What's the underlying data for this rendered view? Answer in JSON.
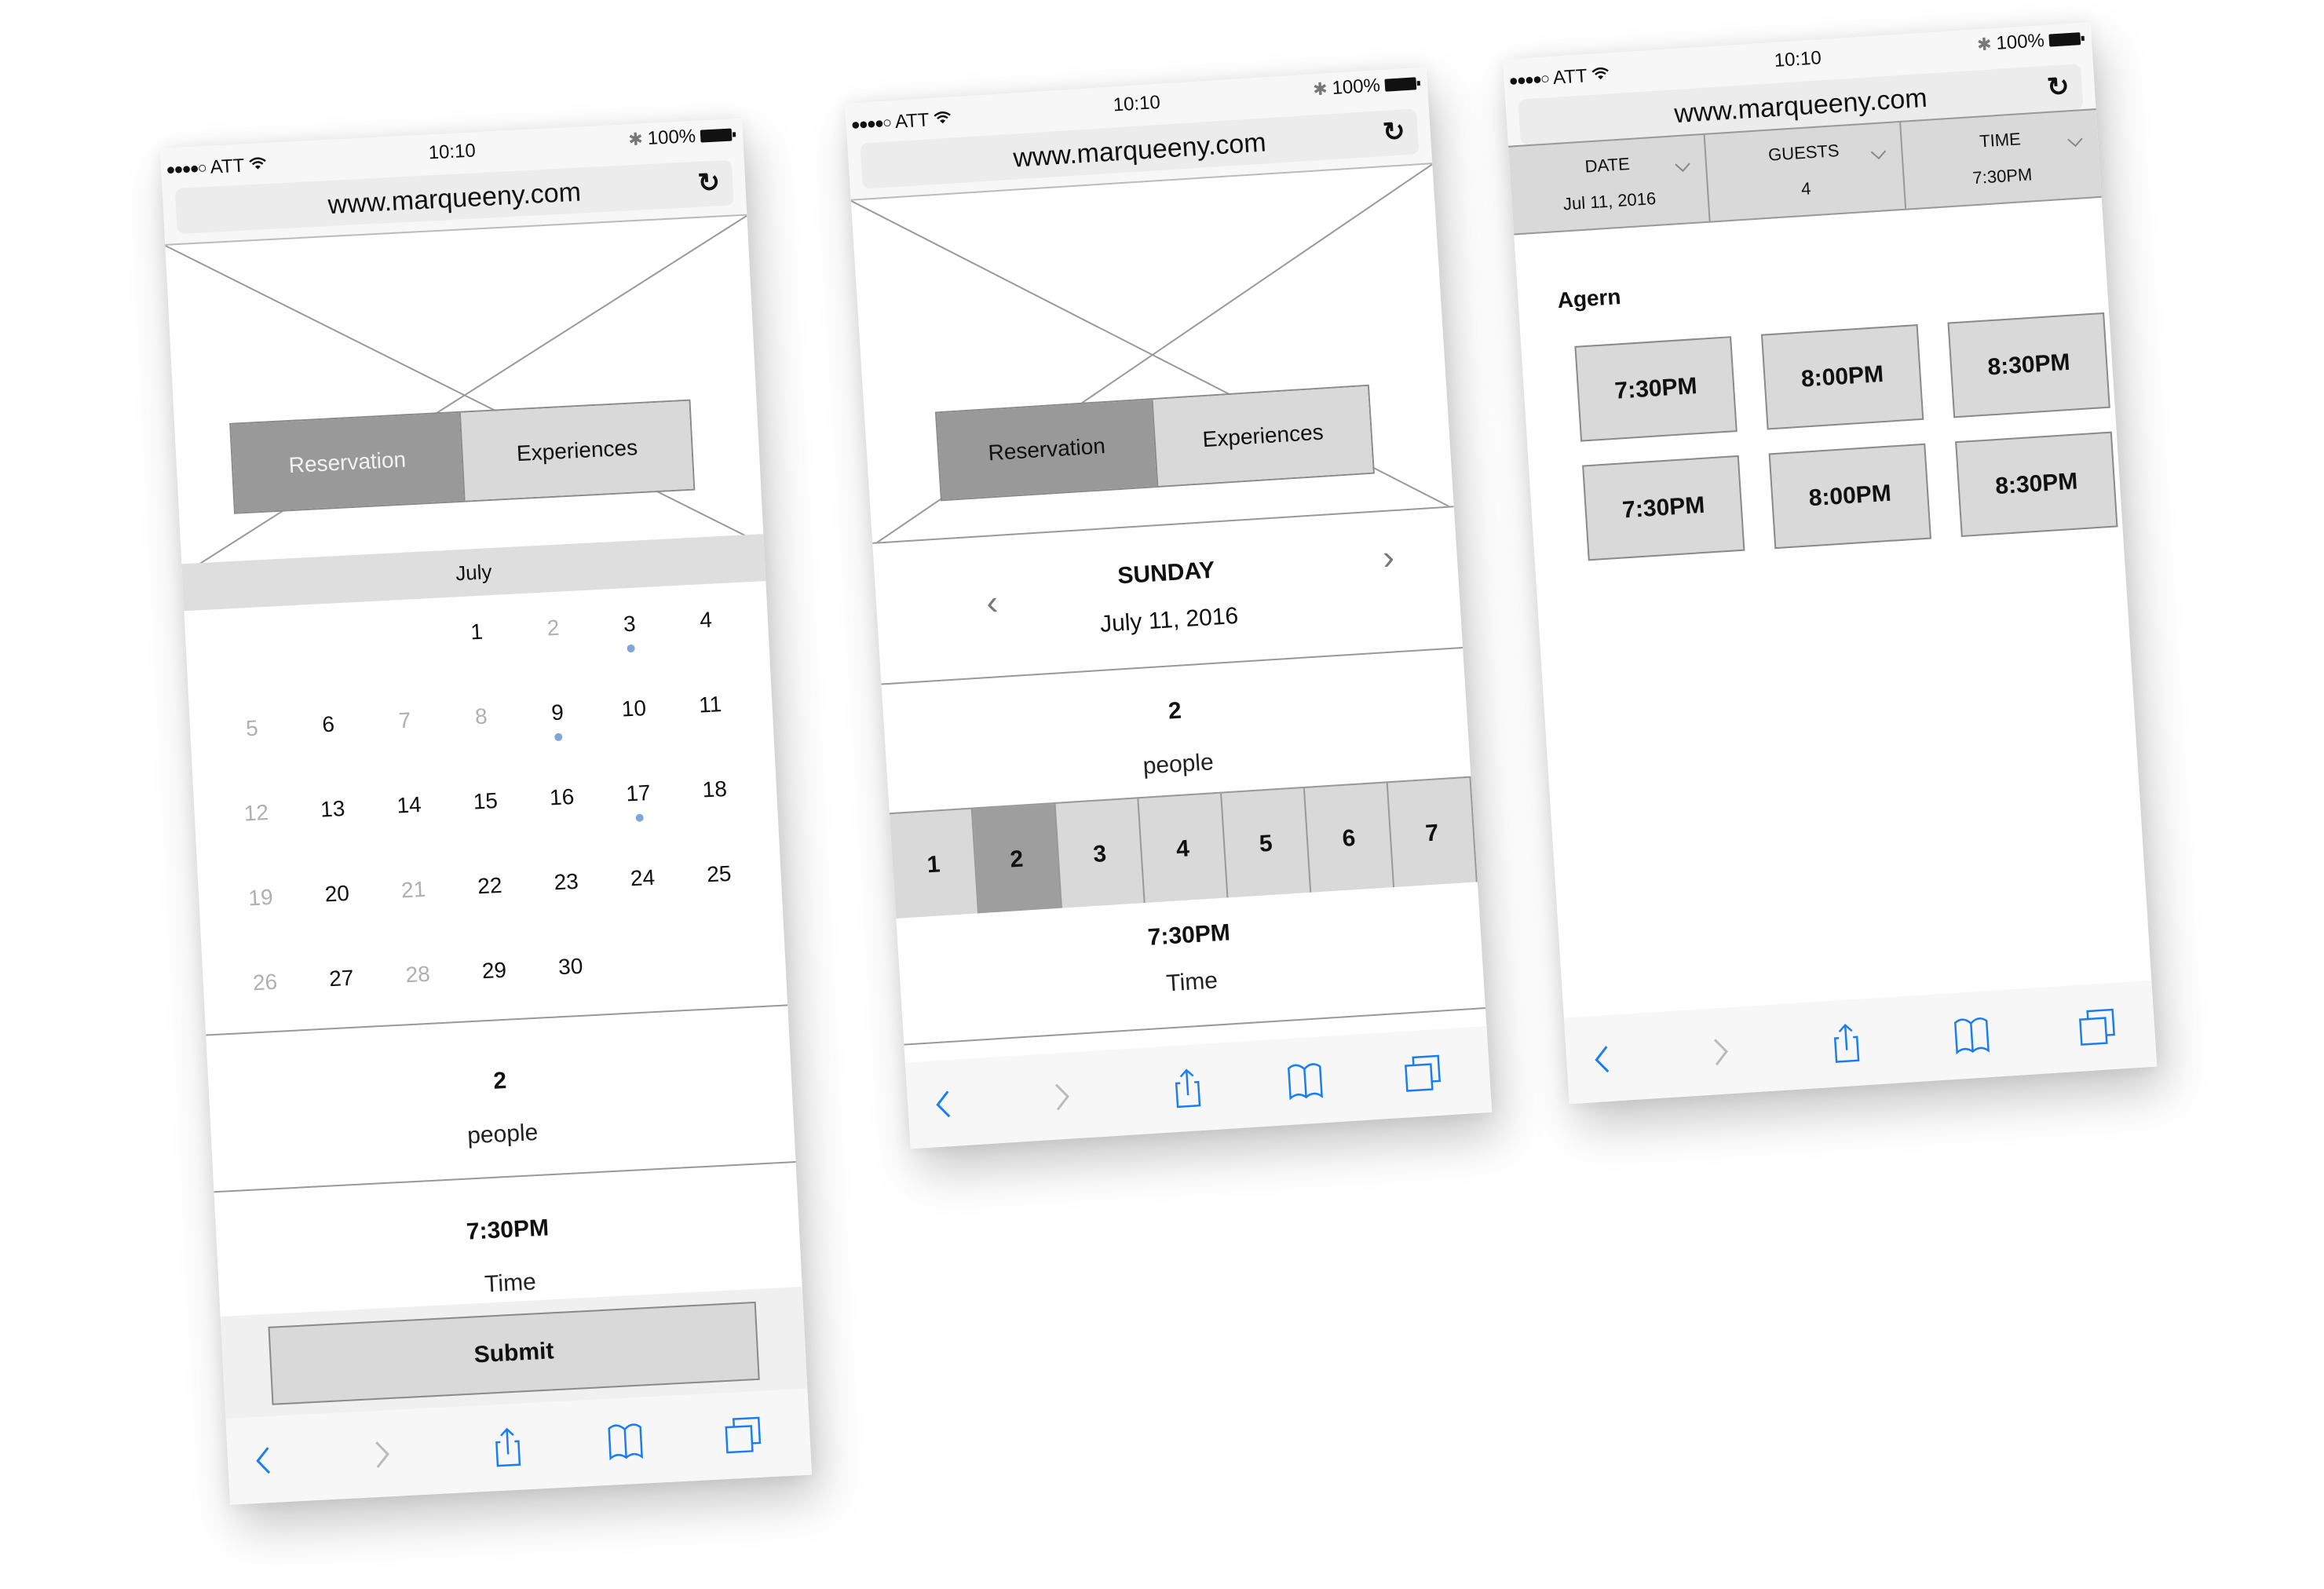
{
  "status_bar": {
    "signal": "●●●●○",
    "carrier": "ATT",
    "time": "10:10",
    "battery": "100%"
  },
  "browser": {
    "url": "www.marqueeny.com",
    "reload_icon": "↻",
    "toolbar_icons": [
      "back-icon",
      "forward-icon",
      "share-icon",
      "bookmarks-icon",
      "tabs-icon"
    ]
  },
  "colors": {
    "ios_blue": "#1a7ef2",
    "calendar_dot": "#7ea6d8",
    "active_tab": "#999999",
    "inactive_tab": "#d9d9d9"
  },
  "phone1": {
    "tabs": [
      "Reservation",
      "Experiences"
    ],
    "active_tab": "Reservation",
    "month": "July",
    "calendar": {
      "leading_blanks": 3,
      "days": [
        {
          "d": "1"
        },
        {
          "d": "2",
          "muted": true
        },
        {
          "d": "3",
          "dot": true
        },
        {
          "d": "4"
        },
        {
          "d": "5",
          "muted": true
        },
        {
          "d": "6"
        },
        {
          "d": "7",
          "muted": true
        },
        {
          "d": "8",
          "muted": true
        },
        {
          "d": "9",
          "dot": true
        },
        {
          "d": "10"
        },
        {
          "d": "11"
        },
        {
          "d": "12",
          "muted": true
        },
        {
          "d": "13"
        },
        {
          "d": "14"
        },
        {
          "d": "15"
        },
        {
          "d": "16"
        },
        {
          "d": "17",
          "dot": true
        },
        {
          "d": "18"
        },
        {
          "d": "19",
          "muted": true
        },
        {
          "d": "20"
        },
        {
          "d": "21",
          "muted": true
        },
        {
          "d": "22"
        },
        {
          "d": "23"
        },
        {
          "d": "24"
        },
        {
          "d": "25"
        },
        {
          "d": "26",
          "muted": true
        },
        {
          "d": "27"
        },
        {
          "d": "28",
          "muted": true
        },
        {
          "d": "29"
        },
        {
          "d": "30"
        }
      ]
    },
    "people_value": "2",
    "people_label": "people",
    "time_value": "7:30PM",
    "time_label": "Time",
    "submit_label": "Submit"
  },
  "phone2": {
    "tabs": [
      "Reservation",
      "Experiences"
    ],
    "active_tab": "Reservation",
    "day_of_week": "SUNDAY",
    "date": "July 11, 2016",
    "prev_icon": "‹",
    "next_icon": "›",
    "people_value": "2",
    "people_label": "people",
    "guest_options": [
      "1",
      "2",
      "3",
      "4",
      "5",
      "6",
      "7"
    ],
    "guest_selected": "2",
    "time_value": "7:30PM",
    "time_label": "Time"
  },
  "phone3": {
    "filters": [
      {
        "label": "DATE",
        "value": "Jul 11, 2016"
      },
      {
        "label": "GUESTS",
        "value": "4"
      },
      {
        "label": "TIME",
        "value": "7:30PM"
      }
    ],
    "venue": "Agern",
    "slots": [
      "7:30PM",
      "8:00PM",
      "8:30PM",
      "7:30PM",
      "8:00PM",
      "8:30PM"
    ]
  }
}
